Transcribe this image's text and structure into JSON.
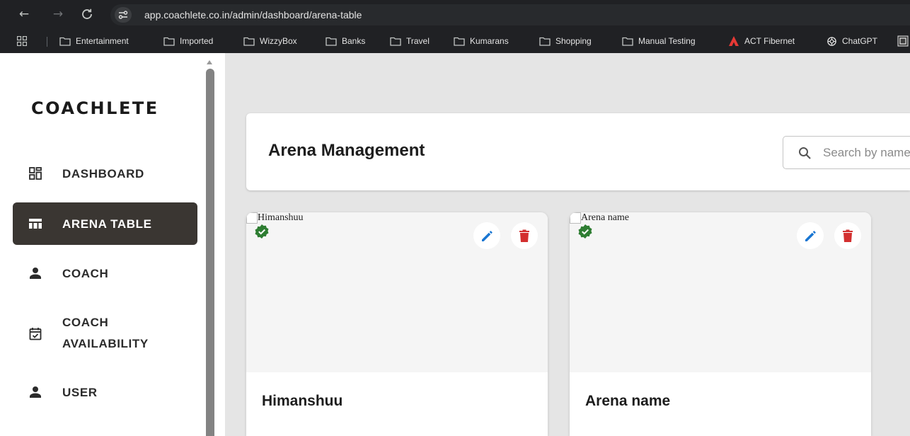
{
  "browser": {
    "url": "app.coachlete.co.in/admin/dashboard/arena-table",
    "bookmarks": [
      {
        "label": "Entertainment",
        "icon": "folder-icon"
      },
      {
        "label": "Imported",
        "icon": "folder-icon"
      },
      {
        "label": "WizzyBox",
        "icon": "folder-icon"
      },
      {
        "label": "Banks",
        "icon": "folder-icon"
      },
      {
        "label": "Travel",
        "icon": "folder-icon"
      },
      {
        "label": "Kumarans",
        "icon": "folder-icon"
      },
      {
        "label": "Shopping",
        "icon": "folder-icon"
      },
      {
        "label": "Manual Testing",
        "icon": "folder-icon"
      },
      {
        "label": "ACT Fibernet",
        "icon": "act-logo-icon"
      },
      {
        "label": "ChatGPT",
        "icon": "chatgpt-icon"
      }
    ]
  },
  "sidebar": {
    "logo": "COACHLETE",
    "items": [
      {
        "label": "DASHBOARD",
        "icon": "dashboard-icon",
        "active": false
      },
      {
        "label": "ARENA TABLE",
        "icon": "table-icon",
        "active": true
      },
      {
        "label": "COACH",
        "icon": "person-icon",
        "active": false
      },
      {
        "label": "COACH AVAILABILITY",
        "label_lines": [
          "COACH",
          "AVAILABILITY"
        ],
        "icon": "calendar-check-icon",
        "active": false
      },
      {
        "label": "USER",
        "icon": "person-icon",
        "active": false
      }
    ]
  },
  "main": {
    "title": "Arena Management",
    "search": {
      "placeholder": "Search by name",
      "value": ""
    },
    "cards": [
      {
        "name": "Himanshuu",
        "image_alt": "Himanshuu",
        "verified": true
      },
      {
        "name": "Arena name",
        "image_alt": "Arena name",
        "verified": true
      }
    ]
  },
  "colors": {
    "active_nav_bg": "#3a3632",
    "edit_icon": "#1976d2",
    "delete_icon": "#d32f2f",
    "verified": "#2e7d32",
    "browser_chrome": "#202124"
  }
}
